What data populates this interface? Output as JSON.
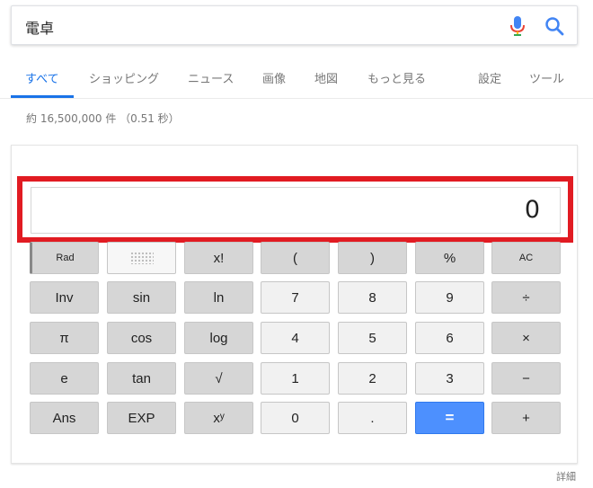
{
  "search": {
    "query": "電卓"
  },
  "tabs": [
    {
      "label": "すべて"
    },
    {
      "label": "ショッピング"
    },
    {
      "label": "ニュース"
    },
    {
      "label": "画像"
    },
    {
      "label": "地図"
    },
    {
      "label": "もっと見る"
    },
    {
      "label": "設定"
    },
    {
      "label": "ツール"
    }
  ],
  "result_stats": "約 16,500,000 件 （0.51 秒）",
  "calculator": {
    "display": "0",
    "keys": [
      [
        "Rad",
        "",
        "x!",
        "(",
        ")",
        "%",
        "AC"
      ],
      [
        "Inv",
        "sin",
        "ln",
        "7",
        "8",
        "9",
        "÷"
      ],
      [
        "π",
        "cos",
        "log",
        "4",
        "5",
        "6",
        "×"
      ],
      [
        "e",
        "tan",
        "√",
        "1",
        "2",
        "3",
        "−"
      ],
      [
        "Ans",
        "EXP",
        "xʸ",
        "0",
        ".",
        "=",
        "+"
      ]
    ]
  },
  "details_link": "詳細",
  "colors": {
    "accent": "#1a73e8",
    "highlight": "#e11b22",
    "equals": "#4d90fe"
  }
}
